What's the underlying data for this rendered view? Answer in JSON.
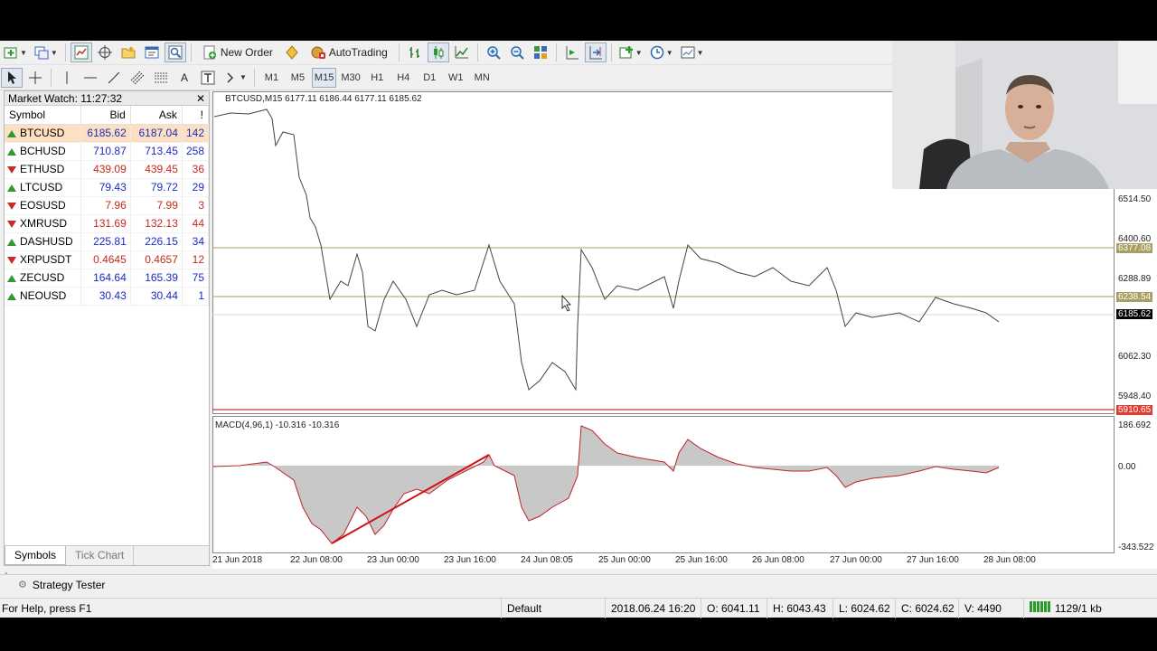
{
  "toolbar1": {
    "new_order_label": "New Order",
    "autotrading_label": "AutoTrading"
  },
  "toolbar2": {
    "timeframes": [
      "M1",
      "M5",
      "M15",
      "M30",
      "H1",
      "H4",
      "D1",
      "W1",
      "MN"
    ],
    "active_timeframe": "M15"
  },
  "market_watch": {
    "title": "Market Watch: 11:27:32",
    "columns": [
      "Symbol",
      "Bid",
      "Ask",
      "!"
    ],
    "rows": [
      {
        "symbol": "BTCUSD",
        "bid": "6185.62",
        "ask": "6187.04",
        "spread": "142",
        "dir": "up"
      },
      {
        "symbol": "BCHUSD",
        "bid": "710.87",
        "ask": "713.45",
        "spread": "258",
        "dir": "up"
      },
      {
        "symbol": "ETHUSD",
        "bid": "439.09",
        "ask": "439.45",
        "spread": "36",
        "dir": "down"
      },
      {
        "symbol": "LTCUSD",
        "bid": "79.43",
        "ask": "79.72",
        "spread": "29",
        "dir": "up"
      },
      {
        "symbol": "EOSUSD",
        "bid": "7.96",
        "ask": "7.99",
        "spread": "3",
        "dir": "down"
      },
      {
        "symbol": "XMRUSD",
        "bid": "131.69",
        "ask": "132.13",
        "spread": "44",
        "dir": "down"
      },
      {
        "symbol": "DASHUSD",
        "bid": "225.81",
        "ask": "226.15",
        "spread": "34",
        "dir": "up"
      },
      {
        "symbol": "XRPUSDT",
        "bid": "0.4645",
        "ask": "0.4657",
        "spread": "12",
        "dir": "down"
      },
      {
        "symbol": "ZECUSD",
        "bid": "164.64",
        "ask": "165.39",
        "spread": "75",
        "dir": "up"
      },
      {
        "symbol": "NEOUSD",
        "bid": "30.43",
        "ask": "30.44",
        "spread": "1",
        "dir": "up"
      }
    ],
    "tabs": [
      "Symbols",
      "Tick Chart"
    ],
    "active_tab": "Symbols"
  },
  "chart": {
    "header": "BTCUSD,M15  6177.11 6186.44 6177.11 6185.62",
    "macd_header": "MACD(4,96,1) -10.316 -10.316",
    "price_axis": [
      "6514.50",
      "6400.60",
      "6288.89",
      "6062.30",
      "5948.40"
    ],
    "macd_axis": [
      "186.692",
      "0.00",
      "-343.522"
    ],
    "levels": {
      "upper": "6377.08",
      "middle": "6238.54",
      "current": "6185.62",
      "lower": "5910.65"
    },
    "time_axis": [
      "21 Jun 2018",
      "22 Jun 08:00",
      "23 Jun 00:00",
      "23 Jun 16:00",
      "24 Jun 08:05",
      "25 Jun 00:00",
      "25 Jun 16:00",
      "26 Jun 08:00",
      "27 Jun 00:00",
      "27 Jun 16:00",
      "28 Jun 08:00"
    ],
    "colors": {
      "level_line": "#a8a060",
      "support_line": "#c00000",
      "price_tag_red": "#e03c31",
      "macd_line": "#c0202a",
      "trendline": "#d01010",
      "histogram": "#c8c8c8"
    }
  },
  "strategy_tester": {
    "label": "Strategy Tester"
  },
  "status_bar": {
    "help": "For Help, press F1",
    "profile": "Default",
    "datetime": "2018.06.24 16:20",
    "open": "O: 6041.11",
    "high": "H: 6043.43",
    "low": "L: 6024.62",
    "close": "C: 6024.62",
    "volume": "V: 4490",
    "traffic": "1129/1 kb"
  }
}
